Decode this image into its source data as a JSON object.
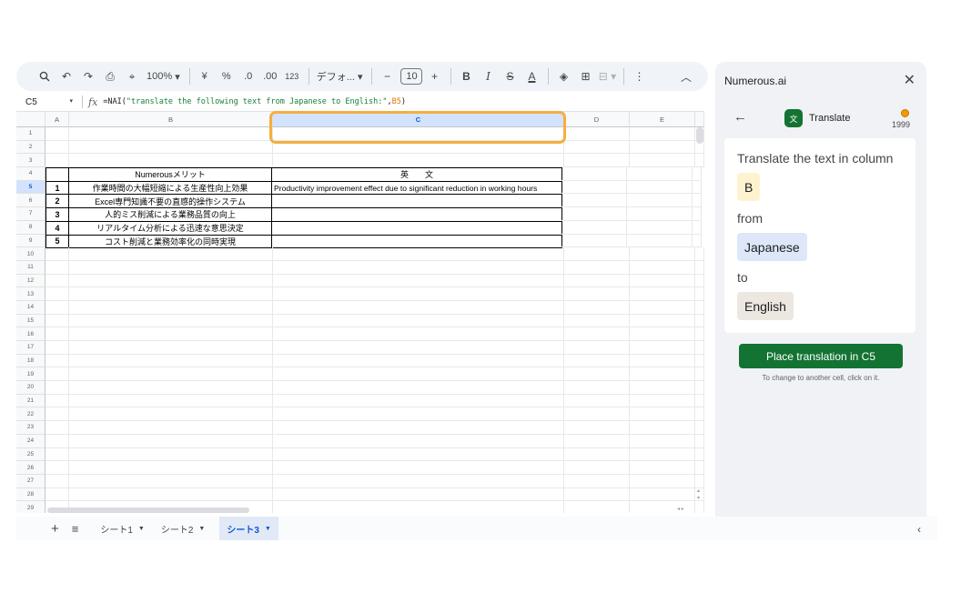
{
  "toolbar": {
    "zoom": "100%",
    "currency": "¥",
    "percent": "%",
    "dec_decrease": ".0",
    "dec_increase": ".00",
    "number_format": "123",
    "font": "デフォ...",
    "font_size": "10",
    "bold": "B",
    "italic": "I",
    "text_color": "A"
  },
  "formula_bar": {
    "name_box": "C5",
    "formula_fn": "=NAI(",
    "formula_str": "\"translate the following text from Japanese to English:\"",
    "formula_comma": ",",
    "formula_ref": "B5",
    "formula_close": ")"
  },
  "grid": {
    "columns": [
      "A",
      "B",
      "C",
      "D",
      "E"
    ],
    "selected_column": "C",
    "selected_row": "5",
    "row_numbers": [
      "1",
      "2",
      "3",
      "4",
      "5",
      "6",
      "7",
      "8",
      "9",
      "10",
      "11",
      "12",
      "13",
      "14",
      "15",
      "16",
      "17",
      "18",
      "19",
      "20",
      "21",
      "22",
      "23",
      "24",
      "25",
      "26",
      "27",
      "28",
      "29"
    ],
    "table_header_b": "Numerousメリット",
    "table_header_c": "英　　文",
    "table_rows": [
      {
        "no": "1",
        "merit": "作業時間の大幅短縮による生産性向上効果",
        "english": "Productivity improvement effect due to significant reduction in working hours"
      },
      {
        "no": "2",
        "merit": "Excel専門知識不要の直感的操作システム",
        "english": ""
      },
      {
        "no": "3",
        "merit": "人的ミス削減による業務品質の向上",
        "english": ""
      },
      {
        "no": "4",
        "merit": "リアルタイム分析による迅速な意思決定",
        "english": ""
      },
      {
        "no": "5",
        "merit": "コスト削減と業務効率化の同時実現",
        "english": ""
      }
    ]
  },
  "sheets": {
    "tabs": [
      "シート1",
      "シート2",
      "シート3"
    ],
    "active": "シート3"
  },
  "panel": {
    "title": "Numerous.ai",
    "mode": "Translate",
    "credits": "1999",
    "line1": "Translate the text in column",
    "column": "B",
    "from_label": "from",
    "from_lang": "Japanese",
    "to_label": "to",
    "to_lang": "English",
    "place_button": "Place translation in C5",
    "hint": "To change to another cell, click on it.",
    "accent": "#137333"
  }
}
